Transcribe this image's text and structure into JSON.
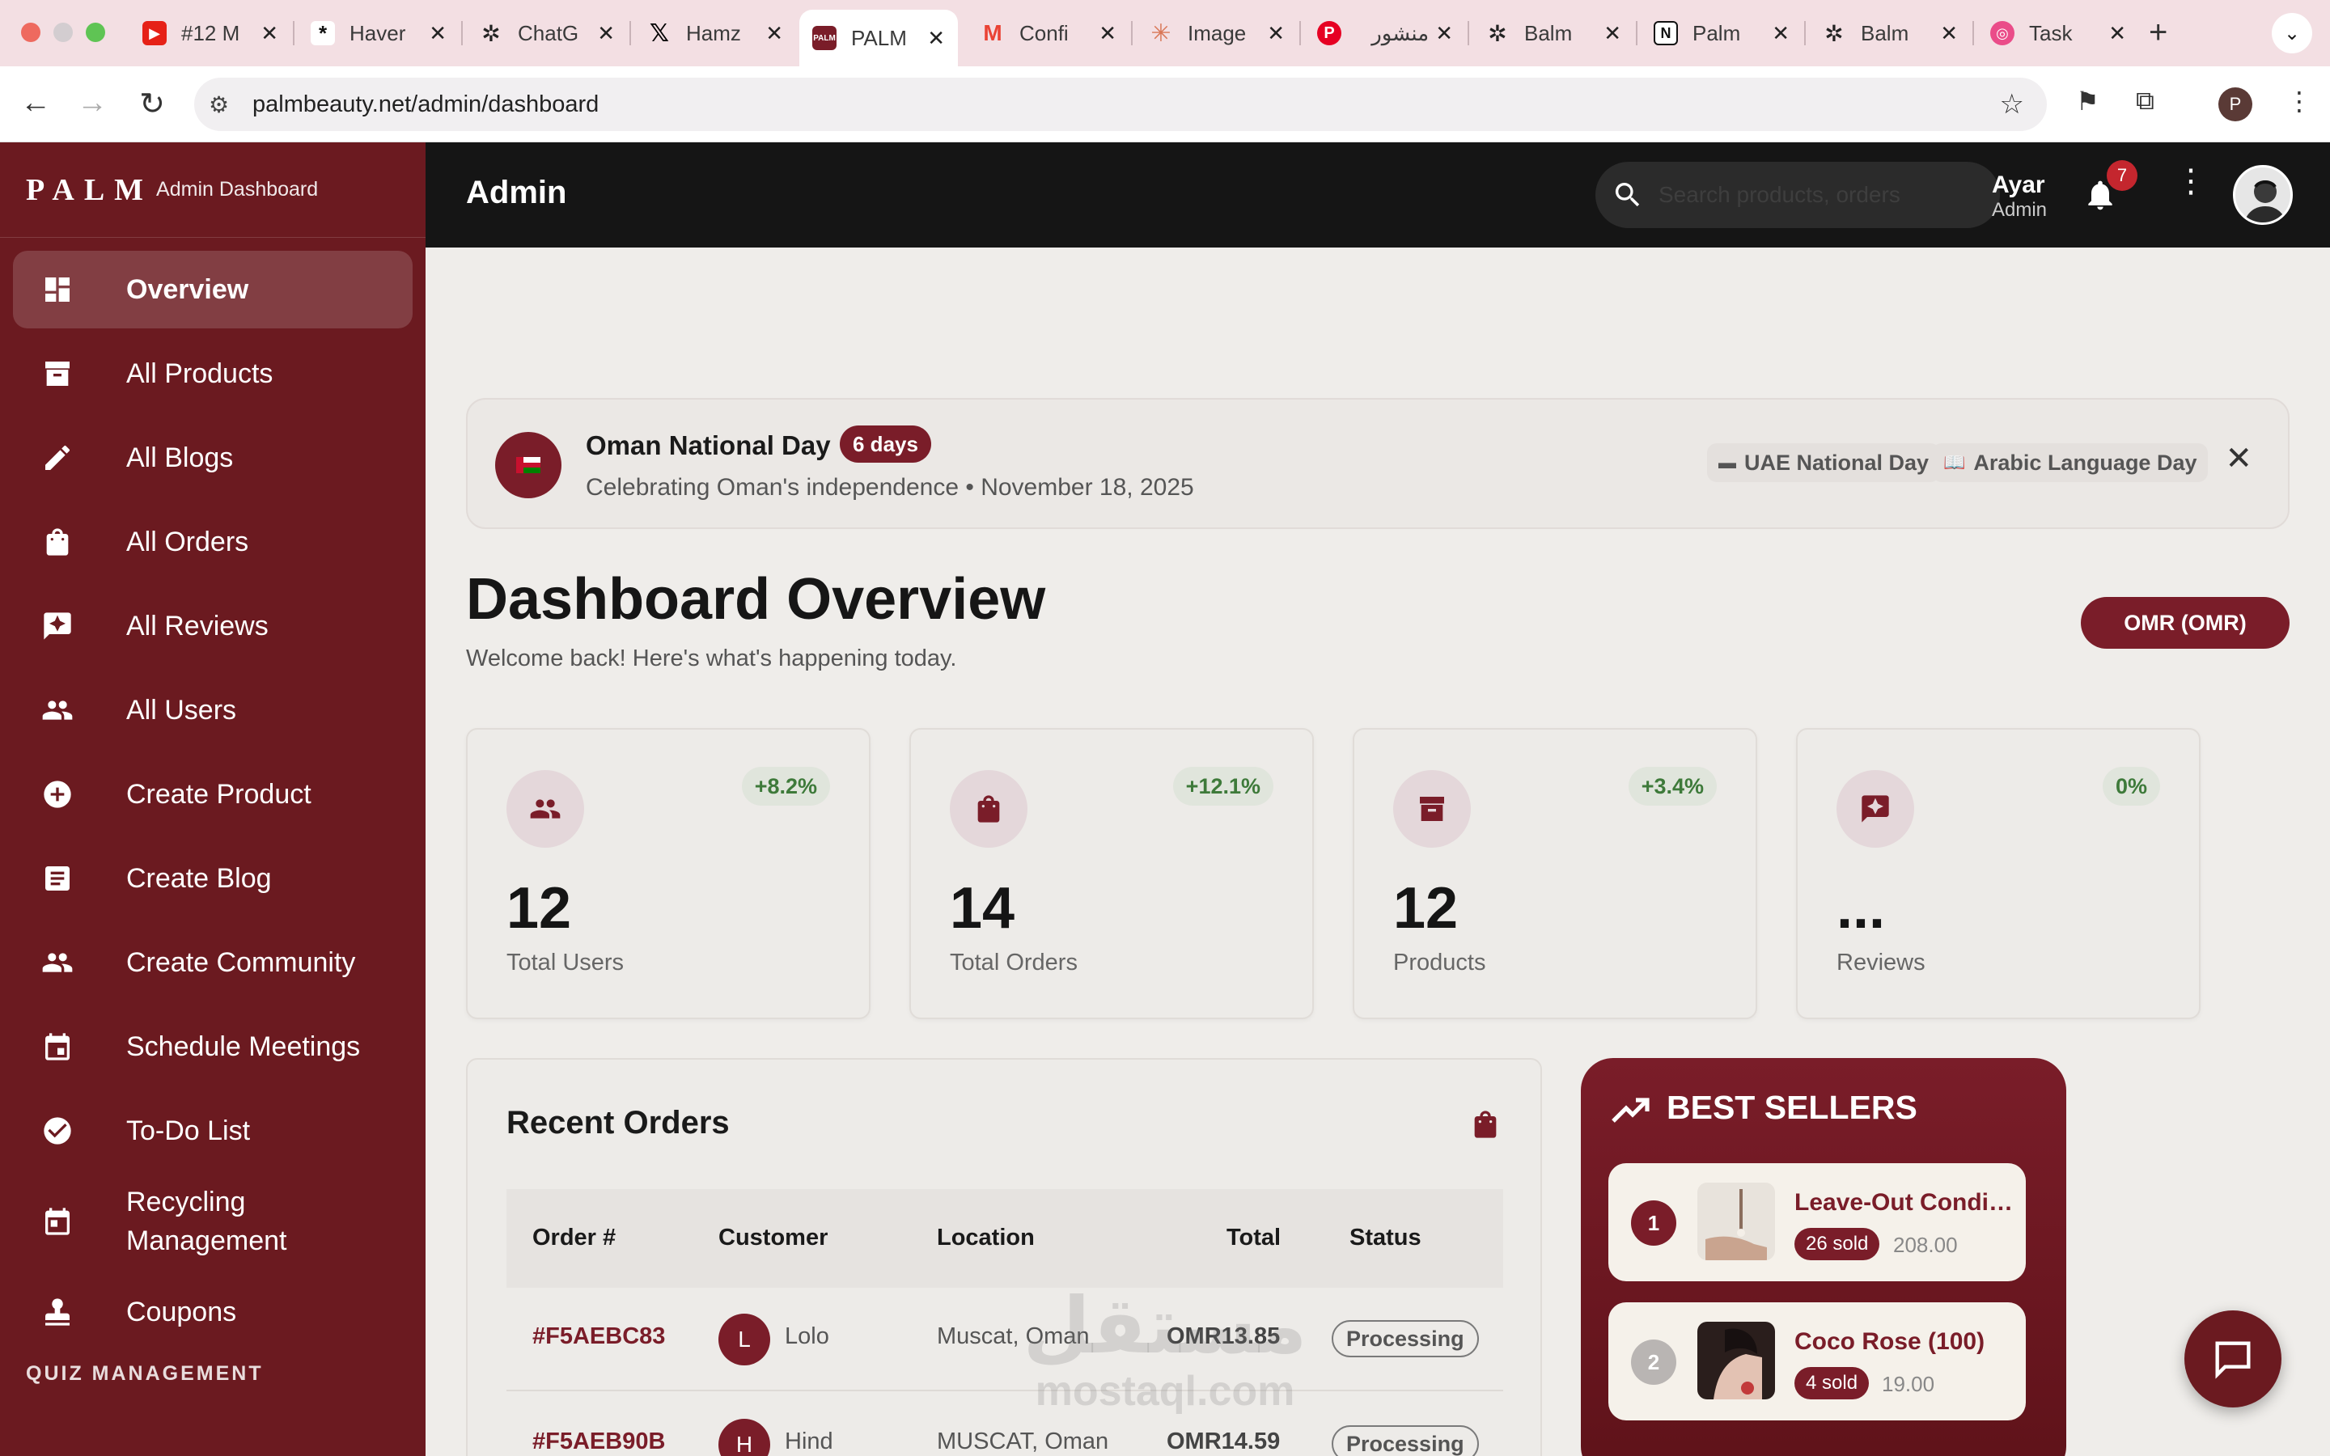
{
  "browser": {
    "tabs": [
      {
        "title": "#12 M",
        "icon": "youtube-icon",
        "color": "#e62117"
      },
      {
        "title": "Haver",
        "icon": "asterisk-icon",
        "color": "#111111"
      },
      {
        "title": "ChatG",
        "icon": "openai-icon",
        "color": "#222222"
      },
      {
        "title": "Hamz",
        "icon": "x-icon",
        "color": "#000000"
      },
      {
        "title": "PALM",
        "icon": "palm-icon",
        "color": "#7a1d29",
        "active": true
      },
      {
        "title": "Confi",
        "icon": "gmail-icon",
        "color": "#ea4335"
      },
      {
        "title": "Image",
        "icon": "claude-icon",
        "color": "#d97757"
      },
      {
        "title": "منشور",
        "icon": "pinterest-icon",
        "color": "#e60023"
      },
      {
        "title": "Balm",
        "icon": "openai-icon",
        "color": "#222222"
      },
      {
        "title": "Palm",
        "icon": "notion-icon",
        "color": "#111111"
      },
      {
        "title": "Balm",
        "icon": "openai-icon",
        "color": "#222222"
      },
      {
        "title": "Task",
        "icon": "dribbble-icon",
        "color": "#ea4c89"
      }
    ],
    "url": "palmbeauty.net/admin/dashboard",
    "profile_initial": "P"
  },
  "sidebar": {
    "brand": "PALM",
    "brand_sub": "Admin Dashboard",
    "items": [
      {
        "label": "Overview",
        "icon": "dashboard-icon"
      },
      {
        "label": "All Products",
        "icon": "archive-icon"
      },
      {
        "label": "All Blogs",
        "icon": "pencil-icon"
      },
      {
        "label": "All Orders",
        "icon": "shopping-bag-icon"
      },
      {
        "label": "All Reviews",
        "icon": "review-icon"
      },
      {
        "label": "All Users",
        "icon": "users-icon"
      },
      {
        "label": "Create Product",
        "icon": "add-circle-icon"
      },
      {
        "label": "Create Blog",
        "icon": "article-icon"
      },
      {
        "label": "Create Community",
        "icon": "group-icon"
      },
      {
        "label": "Schedule Meetings",
        "icon": "calendar-icon"
      },
      {
        "label": "To-Do List",
        "icon": "check-circle-icon"
      },
      {
        "label": "Recycling Management",
        "icon": "recycle-calendar-icon"
      },
      {
        "label": "Coupons",
        "icon": "stamp-icon"
      }
    ],
    "section_label": "QUIZ MANAGEMENT"
  },
  "header": {
    "title": "Admin",
    "search_placeholder": "Search products, orders",
    "user_name": "Ayar",
    "user_role": "Admin",
    "notification_count": "7"
  },
  "holiday": {
    "title": "Oman National Day",
    "badge": "6 days",
    "subtitle": "Celebrating Oman's independence • November 18, 2025",
    "chips": [
      {
        "label": "UAE National Day",
        "icon": "uae-flag-icon"
      },
      {
        "label": "Arabic Language Day",
        "icon": "book-icon"
      }
    ]
  },
  "page": {
    "title": "Dashboard Overview",
    "subtitle": "Welcome back! Here's what's happening today.",
    "currency": "OMR (OMR)"
  },
  "stats": [
    {
      "value": "12",
      "label": "Total Users",
      "delta": "+8.2%",
      "icon": "users-icon"
    },
    {
      "value": "14",
      "label": "Total Orders",
      "delta": "+12.1%",
      "icon": "shopping-bag-icon"
    },
    {
      "value": "12",
      "label": "Products",
      "delta": "+3.4%",
      "icon": "archive-icon"
    },
    {
      "value": "...",
      "label": "Reviews",
      "delta": "0%",
      "icon": "review-icon"
    }
  ],
  "orders": {
    "title": "Recent Orders",
    "columns": [
      "Order #",
      "Customer",
      "Location",
      "Total",
      "Status"
    ],
    "rows": [
      {
        "id": "#F5AEBC83",
        "initial": "L",
        "customer": "Lolo",
        "location": "Muscat, Oman",
        "total": "OMR13.85",
        "status": "Processing"
      },
      {
        "id": "#F5AEB90B",
        "initial": "H",
        "customer": "Hind",
        "location": "MUSCAT, Oman",
        "total": "OMR14.59",
        "status": "Processing"
      }
    ]
  },
  "best_sellers": {
    "title": "BEST SELLERS",
    "items": [
      {
        "rank": "1",
        "name": "Leave-Out Conditioner",
        "sold": "26 sold",
        "price": "208.00",
        "rank_color": "#7a1d29"
      },
      {
        "rank": "2",
        "name": "Coco Rose (100)",
        "sold": "4 sold",
        "price": "19.00",
        "rank_color": "#b9b5b3"
      }
    ]
  },
  "watermark": {
    "arabic": "مستقل",
    "latin": "mostaql.com"
  }
}
